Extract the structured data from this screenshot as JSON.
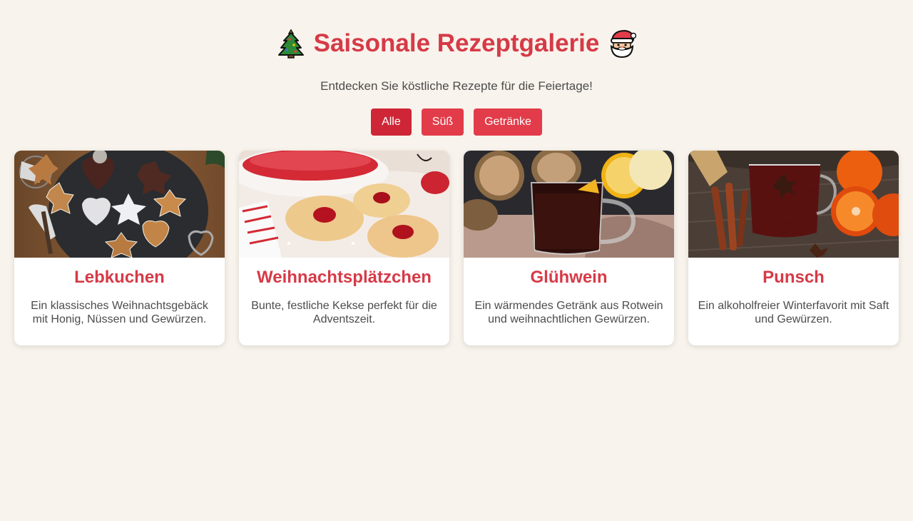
{
  "header": {
    "title": "Saisonale Rezeptgalerie",
    "icons": [
      "christmas-tree-icon",
      "santa-claus-icon"
    ],
    "subtitle": "Entdecken Sie köstliche Rezepte für die Feiertage!"
  },
  "filters": [
    {
      "label": "Alle",
      "active": true
    },
    {
      "label": "Süß",
      "active": false
    },
    {
      "label": "Getränke",
      "active": false
    }
  ],
  "recipes": [
    {
      "title": "Lebkuchen",
      "description": "Ein klassisches Weihnachtsgebäck mit Honig, Nüssen und Gewürzen.",
      "image": "gingerbread-cookies-photo"
    },
    {
      "title": "Weihnachtsplätzchen",
      "description": "Bunte, festliche Kekse perfekt für die Adventszeit.",
      "image": "jam-cookies-photo"
    },
    {
      "title": "Glühwein",
      "description": "Ein wärmendes Getränk aus Rotwein und weihnachtlichen Gewürzen.",
      "image": "mulled-wine-photo"
    },
    {
      "title": "Punsch",
      "description": "Ein alkoholfreier Winterfavorit mit Saft und Gewürzen.",
      "image": "punch-photo"
    }
  ],
  "colors": {
    "background": "#f8f3ec",
    "accent": "#d63a47",
    "button": "#e23c4a",
    "button_active": "#cf2637",
    "text": "#4c4c4c"
  }
}
